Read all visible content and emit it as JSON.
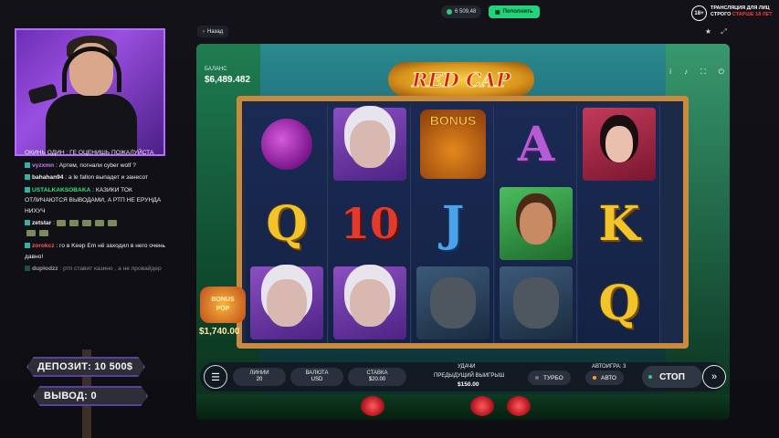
{
  "topbar": {
    "balance": "6 509,48",
    "deposit_label": "Пополнить",
    "age_badge": "18+",
    "age_line1": "ТРАНСЛЯЦИЯ ДЛЯ ЛИЦ",
    "age_line2_a": "СТРОГО ",
    "age_line2_b": "СТАРШЕ 18 ЛЕТ"
  },
  "nav": {
    "back_label": "Назад"
  },
  "chat": {
    "messages": [
      {
        "user": "",
        "text": "ОКИНЬ ОДИН : ГЕ ОЦЕНИШЬ ПОЖАЛУЙСТА"
      },
      {
        "user": "vyzxmn",
        "text": " : Артем, погнали cyber wolf ?"
      },
      {
        "user": "bahahan94",
        "text": " : а le fallon выпадет и занесот"
      },
      {
        "user": "USTALKAKSOBAKA",
        "text": " : КАЗИКИ ТОК ОТЛИЧАЮТСЯ ВЫВОДАМИ, А РТП НЕ ЕРУНДА НИХУЧ"
      },
      {
        "user": "zetstar",
        "text": " :"
      },
      {
        "user": "zorokcz",
        "text": " : го в Keep Em нё заходил в него очень давно!"
      },
      {
        "user": "duplodzz",
        "text": " : ртп ставит казино , а не провайдер"
      }
    ]
  },
  "signs": {
    "deposit": "ДЕПОЗИТ: 10 500$",
    "withdraw": "ВЫВОД: 0"
  },
  "game": {
    "title": "RED CAP",
    "balance_label": "БАЛАНС",
    "balance_value": "$6,489.482",
    "icons": [
      "info-icon",
      "sound-icon",
      "fullscreen-icon",
      "power-icon"
    ],
    "bonus_pop_line1": "BONUS",
    "bonus_pop_line2": "POP",
    "bonus_pop_value": "$1,740.00",
    "reels": [
      [
        "grapes",
        "Q",
        "granny"
      ],
      [
        "granny",
        "10",
        "granny"
      ],
      [
        "bonus",
        "J",
        "wolf"
      ],
      [
        "A",
        "hunter",
        "wolf"
      ],
      [
        "redcap",
        "K",
        "Q"
      ]
    ],
    "bonus_text": "BONUS"
  },
  "controls": {
    "lines_label": "ЛИНИИ",
    "lines_value": "20",
    "currency_label": "ВАЛЮТА",
    "currency_value": "USD",
    "bet_label": "СТАВКА",
    "bet_value": "$20.00",
    "good_luck": "УДАЧИ",
    "prev_win_label": "ПРЕДЫДУЩИЙ ВЫИГРЫШ",
    "prev_win_value": "$150.00",
    "autoplay_label": "АВТОИГРА: 3",
    "turbo_label": "ТУРБО",
    "auto_label": "АВТО",
    "stop_label": "СТОП"
  }
}
